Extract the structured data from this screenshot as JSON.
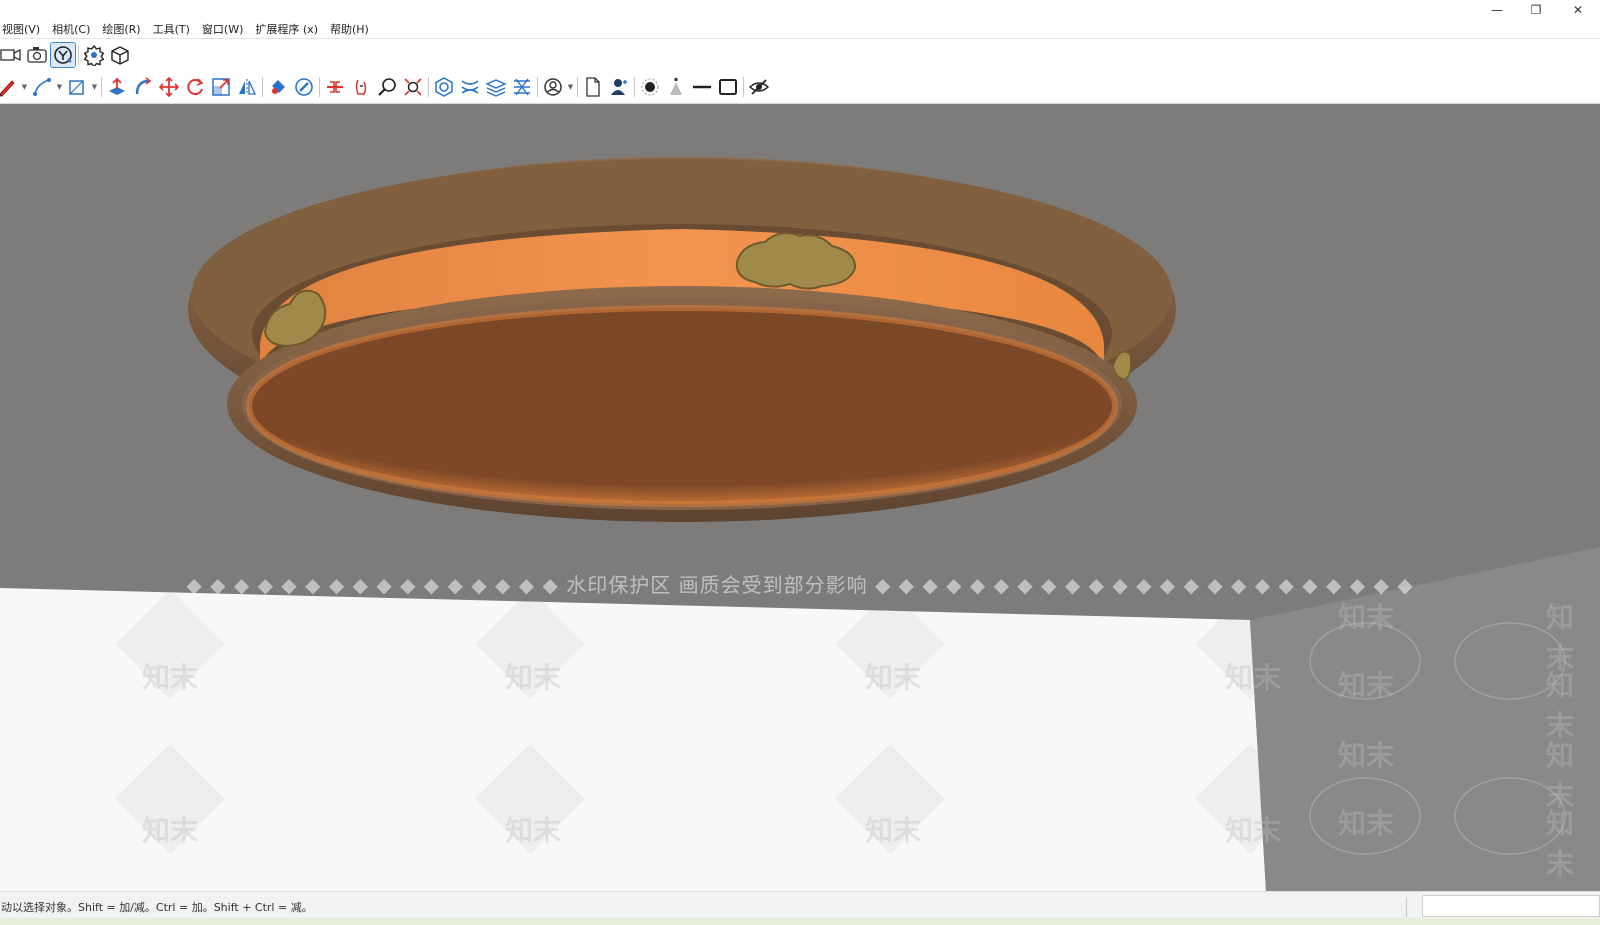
{
  "window": {
    "minimize_glyph": "—",
    "restore_glyph": "❐",
    "close_glyph": "✕"
  },
  "menu": {
    "items": [
      {
        "label": "视图(V)"
      },
      {
        "label": "相机(C)"
      },
      {
        "label": "绘图(R)"
      },
      {
        "label": "工具(T)"
      },
      {
        "label": "窗口(W)"
      },
      {
        "label": "扩展程序 (x)"
      },
      {
        "label": "帮助(H)"
      }
    ]
  },
  "toolbar_top": {
    "tools": [
      {
        "name": "video-camera-icon"
      },
      {
        "name": "photo-camera-icon"
      },
      {
        "name": "style-builder-icon",
        "active": true
      },
      {
        "name": "component-icon"
      },
      {
        "name": "box-export-icon"
      }
    ]
  },
  "toolbar_main": {
    "groups": [
      [
        "pencil-icon",
        "line-icon",
        "rectangle-icon"
      ],
      [
        "push-pull-icon",
        "follow-me-icon",
        "move-icon",
        "rotate-icon",
        "scale-icon",
        "flip-icon"
      ],
      [
        "paint-bucket-icon",
        "eraser-icon"
      ],
      [
        "section-plane-icon",
        "orbit-icon",
        "zoom-icon",
        "zoom-extents-icon"
      ],
      [
        "solid-tools-icon",
        "sandbox-icon",
        "layers-icon",
        "styles-icon"
      ],
      [
        "account-icon"
      ],
      [
        "new-page-icon",
        "user-icon"
      ],
      [
        "point-icon",
        "cone-icon",
        "horizontal-line-icon",
        "square-icon",
        "hide-icon"
      ]
    ]
  },
  "viewport": {
    "background_color": "#7d7c7b",
    "watermark_banner": "◆ ◆ ◆ ◆ ◆ ◆ ◆ ◆ ◆ ◆ ◆ ◆ ◆ ◆ ◆ ◆ 水印保护区   画质会受到部分影响 ◆ ◆ ◆ ◆ ◆ ◆ ◆ ◆ ◆ ◆ ◆ ◆ ◆ ◆ ◆ ◆ ◆ ◆ ◆ ◆ ◆ ◆ ◆",
    "watermark_tile_text": "知末",
    "colors": {
      "wood": "#7a5a3e",
      "wood_light": "#8d6b4c",
      "orange_band": "#f08d47",
      "disc_face": "#7a4726",
      "ornament": "#a08a4b"
    }
  },
  "status": {
    "hint": "动以选择对象。Shift = 加/减。Ctrl = 加。Shift + Ctrl = 减。",
    "measurements_value": ""
  }
}
